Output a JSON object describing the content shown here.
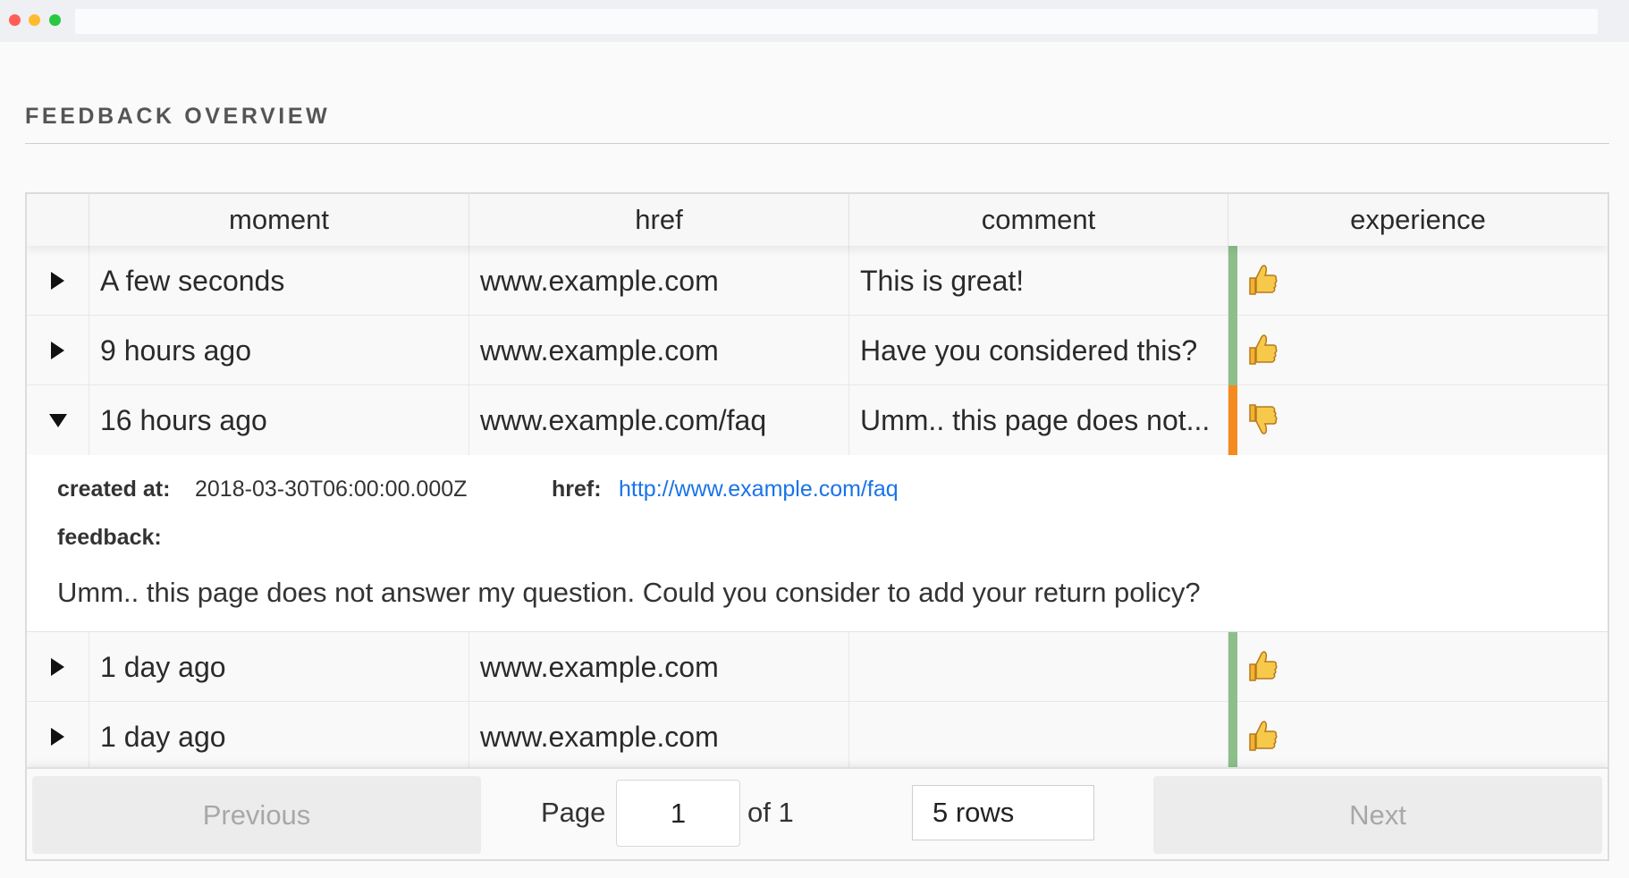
{
  "page": {
    "title": "FEEDBACK OVERVIEW"
  },
  "table": {
    "columns": [
      "moment",
      "href",
      "comment",
      "experience"
    ],
    "rows": [
      {
        "moment": "A few seconds",
        "href": "www.example.com",
        "comment": "This is great!",
        "experience": "positive",
        "experience_color": "#8dbf8b",
        "expanded": false
      },
      {
        "moment": "9 hours ago",
        "href": "www.example.com",
        "comment": "Have you considered this?",
        "experience": "positive",
        "experience_color": "#8dbf8b",
        "expanded": false
      },
      {
        "moment": "16 hours ago",
        "href": "www.example.com/faq",
        "comment": "Umm.. this page does not...",
        "experience": "negative",
        "experience_color": "#f48b1e",
        "expanded": true
      },
      {
        "moment": "1 day ago",
        "href": "www.example.com",
        "comment": "",
        "experience": "positive",
        "experience_color": "#8dbf8b",
        "expanded": false
      },
      {
        "moment": "1 day ago",
        "href": "www.example.com",
        "comment": "",
        "experience": "positive",
        "experience_color": "#8dbf8b",
        "expanded": false
      }
    ],
    "detail": {
      "created_label": "created at:",
      "created_value": "2018-03-30T06:00:00.000Z",
      "href_label": "href:",
      "href_value": "http://www.example.com/faq",
      "feedback_label": "feedback:",
      "feedback_text": "Umm.. this page does not answer my question. Could you consider to add your return policy?"
    }
  },
  "pagination": {
    "previous_label": "Previous",
    "page_label": "Page",
    "page_value": "1",
    "of_label": "of 1",
    "rows_value": "5 rows",
    "next_label": "Next"
  },
  "icons": {
    "positive": "thumbs-up-icon",
    "negative": "thumbs-down-icon"
  },
  "colors": {
    "positive": "#8dbf8b",
    "negative": "#f48b1e",
    "link": "#1a73e8"
  }
}
